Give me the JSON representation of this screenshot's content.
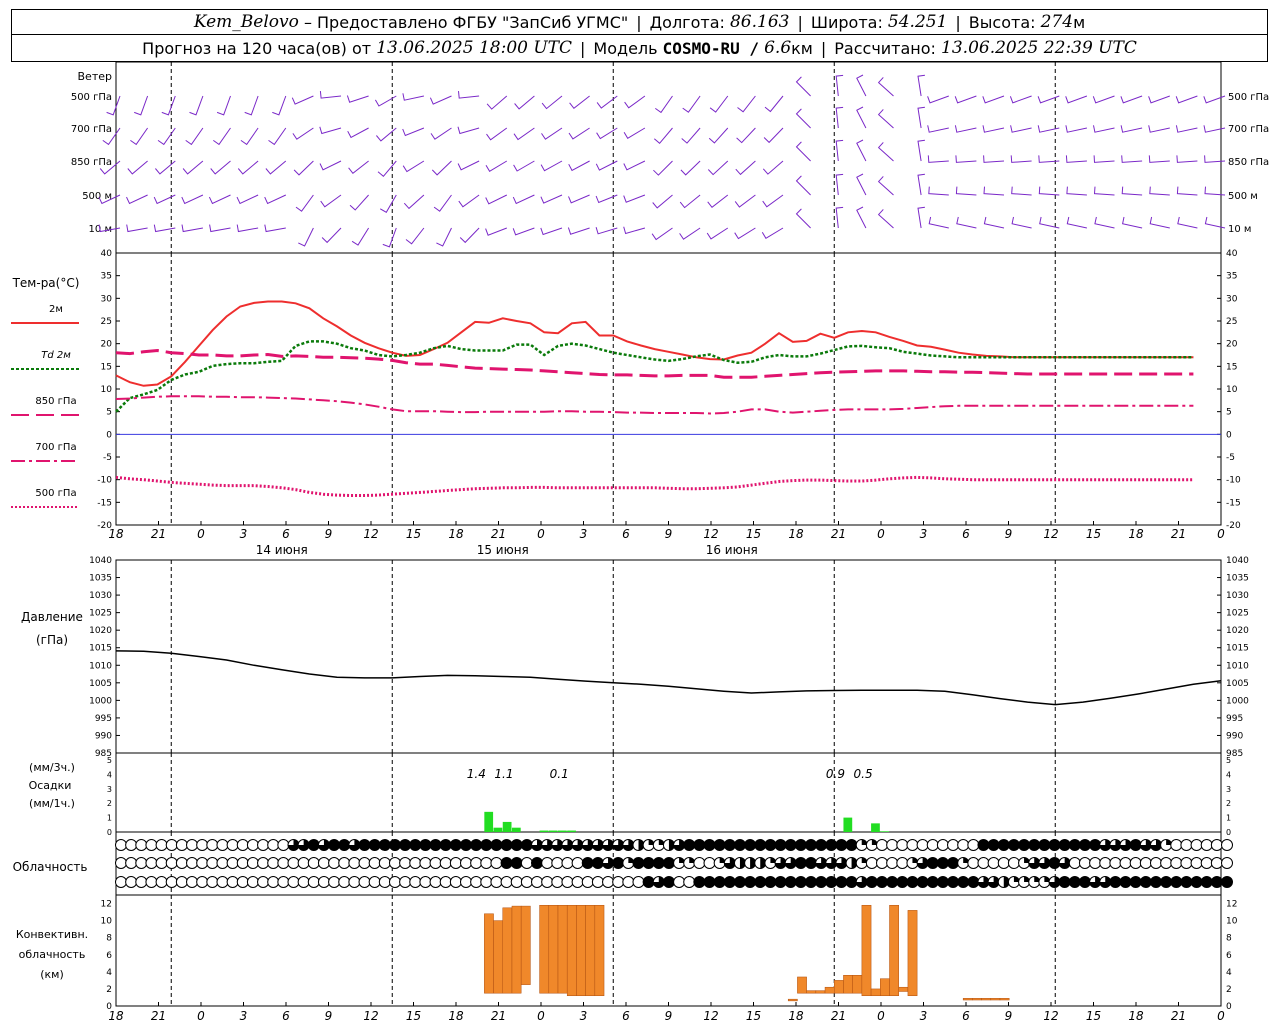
{
  "header": {
    "station": "Kem_Belovo",
    "provider": "– Предоставлено ФГБУ \"ЗапСиб УГМС\"",
    "lon_label": "Долгота:",
    "lon": "86.163",
    "lat_label": "Широта:",
    "lat": "54.251",
    "alt_label": "Высота:",
    "alt": "274",
    "alt_unit": "м",
    "forecast_label": "Прогноз на 120 часа(ов) от",
    "forecast_from": "13.06.2025 18:00 UTC",
    "model_label": "Модель",
    "model": "COSMO-RU /",
    "resolution": "6.6",
    "resolution_unit": "км",
    "computed_label": "Рассчитано:",
    "computed": "13.06.2025 22:39 UTC"
  },
  "colors": {
    "t2m": "#ee2e2e",
    "td2m": "#0a7a0a",
    "t850": "#e0146e",
    "t700": "#e0146e",
    "t500": "#e0146e",
    "wind": "#7a28c8",
    "precip": "#22dd22",
    "convective": "#f0882a",
    "pressure": "#000000"
  },
  "chart_data": [
    {
      "id": "wind",
      "type": "barbs",
      "title": "Ветер",
      "levels": [
        "500 гПа",
        "700 гПа",
        "850 гПа",
        "500  м",
        "10   м"
      ]
    },
    {
      "id": "temperature",
      "type": "line",
      "title": "Тем-ра(°C)",
      "ylim": [
        -20,
        40
      ],
      "yticks": [
        -20,
        -15,
        -10,
        -5,
        0,
        5,
        10,
        15,
        20,
        25,
        30,
        35,
        40
      ],
      "x_hours": [
        0,
        3,
        6,
        9,
        12,
        15,
        18,
        21,
        24,
        27,
        30,
        33,
        36,
        39,
        42,
        45,
        48,
        51,
        54,
        57,
        60,
        63,
        66,
        69,
        72,
        75,
        78,
        81,
        84,
        87,
        90,
        93,
        96,
        99,
        102,
        105,
        108,
        111,
        114,
        117,
        120,
        123,
        126,
        129,
        132,
        135,
        138,
        141,
        144,
        147,
        150,
        153,
        156,
        159,
        162,
        165,
        168,
        171,
        174,
        177,
        180,
        183,
        186,
        189,
        192,
        195,
        198,
        201,
        204,
        207,
        210,
        213,
        216,
        219,
        222,
        225,
        228,
        231,
        234
      ],
      "series": [
        {
          "name": "2м",
          "key": "t2m",
          "values": [
            13.0,
            11.5,
            10.7,
            11.0,
            12.8,
            16.0,
            19.5,
            23.0,
            26.0,
            28.2,
            29.0,
            29.3,
            29.3,
            28.9,
            27.8,
            25.6,
            23.8,
            21.8,
            20.2,
            19.0,
            18.0,
            17.3,
            17.5,
            18.8,
            20.2,
            22.5,
            24.8,
            24.6,
            25.6,
            25.0,
            24.5,
            22.5,
            22.3,
            24.5,
            24.8,
            21.8,
            21.8,
            20.5,
            19.6,
            18.8,
            18.2,
            17.6,
            17.0,
            16.6,
            16.5,
            17.4,
            18.0,
            20.0,
            22.3,
            20.4,
            20.6,
            22.2,
            21.3,
            22.5,
            22.8,
            22.5,
            21.5,
            20.6,
            19.6,
            19.3,
            18.7,
            18.0,
            17.6,
            17.3,
            17.2,
            17.0,
            17.0,
            17.0,
            17.0,
            17.0,
            17.0,
            17.0,
            17.0,
            17.0,
            17.0,
            17.0,
            17.0,
            17.0,
            17.0
          ]
        },
        {
          "name": "Td  2м",
          "key": "td2m",
          "values": [
            5.0,
            8.0,
            8.8,
            9.8,
            12.0,
            13.2,
            13.8,
            15.1,
            15.5,
            15.7,
            15.7,
            16.0,
            16.2,
            19.5,
            20.5,
            20.5,
            20.0,
            19.0,
            18.5,
            17.5,
            17.2,
            17.5,
            18.0,
            19.0,
            19.5,
            18.8,
            18.5,
            18.5,
            18.5,
            19.8,
            19.8,
            17.5,
            19.5,
            20.0,
            19.6,
            18.8,
            18.0,
            17.5,
            17.0,
            16.5,
            16.2,
            16.6,
            17.2,
            17.6,
            16.4,
            15.8,
            16.0,
            17.0,
            17.5,
            17.2,
            17.2,
            17.8,
            18.6,
            19.4,
            19.5,
            19.2,
            19.0,
            18.2,
            17.8,
            17.4,
            17.2,
            17.0,
            17.0,
            17.0,
            17.0,
            17.0,
            17.0,
            17.0,
            17.0,
            17.0,
            17.0,
            17.0,
            17.0,
            17.0,
            17.0,
            17.0,
            17.0,
            17.0,
            17.0
          ]
        },
        {
          "name": "850 гПа",
          "key": "t850",
          "values": [
            18.0,
            17.8,
            18.2,
            18.5,
            18.0,
            17.8,
            17.5,
            17.5,
            17.3,
            17.3,
            17.5,
            17.6,
            17.2,
            17.3,
            17.2,
            17.0,
            17.0,
            16.9,
            16.8,
            16.6,
            16.3,
            15.8,
            15.5,
            15.5,
            15.2,
            14.9,
            14.6,
            14.5,
            14.4,
            14.3,
            14.2,
            14.0,
            13.8,
            13.6,
            13.4,
            13.2,
            13.1,
            13.1,
            13.0,
            12.9,
            12.9,
            13.0,
            13.0,
            13.0,
            12.6,
            12.6,
            12.6,
            12.8,
            13.0,
            13.2,
            13.4,
            13.6,
            13.7,
            13.8,
            13.9,
            14.0,
            14.0,
            14.0,
            13.9,
            13.8,
            13.8,
            13.7,
            13.7,
            13.6,
            13.5,
            13.4,
            13.3,
            13.3,
            13.3,
            13.3,
            13.3,
            13.3,
            13.3,
            13.3,
            13.3,
            13.3,
            13.3,
            13.3,
            13.3
          ]
        },
        {
          "name": "700 гПа",
          "key": "t700",
          "values": [
            7.8,
            7.9,
            8.1,
            8.3,
            8.4,
            8.4,
            8.4,
            8.3,
            8.3,
            8.2,
            8.2,
            8.1,
            8.0,
            7.9,
            7.7,
            7.5,
            7.3,
            7.0,
            6.6,
            6.1,
            5.5,
            5.1,
            5.1,
            5.1,
            5.0,
            4.9,
            4.9,
            5.0,
            5.0,
            5.0,
            5.0,
            5.0,
            5.1,
            5.1,
            5.0,
            5.0,
            4.9,
            4.8,
            4.8,
            4.7,
            4.7,
            4.7,
            4.7,
            4.6,
            4.7,
            5.0,
            5.5,
            5.5,
            5.0,
            4.8,
            5.0,
            5.2,
            5.4,
            5.5,
            5.5,
            5.5,
            5.5,
            5.6,
            5.8,
            6.0,
            6.2,
            6.3,
            6.3,
            6.3,
            6.3,
            6.3,
            6.3,
            6.3,
            6.3,
            6.3,
            6.3,
            6.3,
            6.3,
            6.3,
            6.3,
            6.3,
            6.3,
            6.3,
            6.3
          ]
        },
        {
          "name": "500 гПа",
          "key": "t500",
          "values": [
            -9.5,
            -9.8,
            -10.0,
            -10.3,
            -10.6,
            -10.8,
            -11.0,
            -11.2,
            -11.3,
            -11.3,
            -11.3,
            -11.5,
            -11.8,
            -12.2,
            -12.8,
            -13.2,
            -13.4,
            -13.5,
            -13.5,
            -13.4,
            -13.2,
            -13.0,
            -12.8,
            -12.6,
            -12.4,
            -12.2,
            -12.0,
            -11.9,
            -11.8,
            -11.8,
            -11.7,
            -11.7,
            -11.8,
            -11.8,
            -11.8,
            -11.8,
            -11.8,
            -11.8,
            -11.8,
            -11.8,
            -11.9,
            -12.0,
            -12.0,
            -11.9,
            -11.8,
            -11.6,
            -11.2,
            -10.8,
            -10.4,
            -10.2,
            -10.1,
            -10.1,
            -10.2,
            -10.3,
            -10.3,
            -10.1,
            -9.8,
            -9.6,
            -9.5,
            -9.6,
            -9.8,
            -9.9,
            -10.0,
            -10.0,
            -10.0,
            -10.0,
            -10.0,
            -10.0,
            -10.0,
            -10.0,
            -10.0,
            -10.0,
            -10.0,
            -10.0,
            -10.0,
            -10.0,
            -10.0,
            -10.0,
            -10.0
          ]
        }
      ]
    },
    {
      "id": "pressure",
      "type": "line",
      "title": "Давление",
      "unit": "(гПа)",
      "ylim": [
        985,
        1040
      ],
      "yticks": [
        985,
        990,
        995,
        1000,
        1005,
        1010,
        1015,
        1020,
        1025,
        1030,
        1035,
        1040
      ],
      "x_hours": [
        0,
        3,
        6,
        9,
        12,
        15,
        18,
        21,
        24,
        27,
        30,
        33,
        36,
        39,
        42,
        45,
        48,
        51,
        54,
        57,
        60,
        63,
        66,
        69,
        72,
        75,
        78,
        81,
        84,
        87,
        90,
        93,
        96,
        99,
        102,
        105,
        108,
        111,
        114,
        117,
        120
      ],
      "values": [
        1014.1,
        1014.0,
        1013.4,
        1012.5,
        1011.5,
        1010.0,
        1008.7,
        1007.5,
        1006.6,
        1006.4,
        1006.4,
        1006.8,
        1007.1,
        1007.0,
        1006.8,
        1006.6,
        1006.0,
        1005.5,
        1005.0,
        1004.6,
        1004.0,
        1003.3,
        1002.6,
        1002.1,
        1002.4,
        1002.7,
        1002.8,
        1002.9,
        1002.9,
        1002.9,
        1002.6,
        1001.6,
        1000.5,
        999.5,
        998.8,
        999.5,
        1000.6,
        1001.8,
        1003.2,
        1004.6,
        1005.6
      ]
    },
    {
      "id": "precip",
      "type": "bar",
      "title": "Осадки",
      "units": [
        "(мм/3ч.)",
        "(мм/1ч.)"
      ],
      "ylim": [
        0,
        5
      ],
      "yticks": [
        0,
        1,
        2,
        3,
        4,
        5
      ],
      "labels": [
        {
          "hour": 40,
          "text": "1.4"
        },
        {
          "hour": 43,
          "text": "1.1"
        },
        {
          "hour": 49,
          "text": "0.1"
        },
        {
          "hour": 79,
          "text": "0.9"
        },
        {
          "hour": 82,
          "text": "0.5"
        }
      ],
      "bars": [
        {
          "hour": 40,
          "value": 1.4
        },
        {
          "hour": 41,
          "value": 0.3
        },
        {
          "hour": 42,
          "value": 0.7
        },
        {
          "hour": 43,
          "value": 0.3
        },
        {
          "hour": 46,
          "value": 0.1
        },
        {
          "hour": 47,
          "value": 0.1
        },
        {
          "hour": 48,
          "value": 0.1
        },
        {
          "hour": 49,
          "value": 0.1
        },
        {
          "hour": 79,
          "value": 1.0
        },
        {
          "hour": 82,
          "value": 0.6
        },
        {
          "hour": 83,
          "value": 0.05
        }
      ]
    },
    {
      "id": "cloudiness",
      "type": "table",
      "title": "Облачность",
      "rows": [
        "00000000000000000334344344444444444444444333333333321123444444444444444441100000000004444444444443334331000000",
        "00000000000000000000000000000000000000440400004434144441100132221334433321000013444100000133430000000000000000",
        "00000000000000000000000000000000000000000000000000004340044444444444444443444444444443321111344433444444444444"
      ]
    },
    {
      "id": "convective",
      "type": "bar",
      "title": "Конвективн.",
      "title2": "облачность",
      "unit": "(км)",
      "ylim": [
        0,
        13
      ],
      "yticks": [
        0,
        2,
        4,
        6,
        8,
        10,
        12
      ],
      "bars": [
        [
          40,
          1.5,
          10.8
        ],
        [
          41,
          1.5,
          10.0
        ],
        [
          42,
          1.5,
          11.5
        ],
        [
          43,
          1.5,
          11.7
        ],
        [
          44,
          2.5,
          11.7
        ],
        [
          46,
          1.5,
          11.8
        ],
        [
          47,
          1.5,
          11.8
        ],
        [
          48,
          1.5,
          11.8
        ],
        [
          49,
          1.2,
          11.8
        ],
        [
          50,
          1.2,
          11.8
        ],
        [
          51,
          1.2,
          11.8
        ],
        [
          52,
          1.2,
          11.8
        ],
        [
          73,
          0.6,
          0.8
        ],
        [
          74,
          1.5,
          3.4
        ],
        [
          75,
          1.5,
          1.8
        ],
        [
          76,
          1.5,
          1.8
        ],
        [
          77,
          1.5,
          2.2
        ],
        [
          78,
          1.5,
          3.0
        ],
        [
          79,
          1.5,
          3.6
        ],
        [
          80,
          1.5,
          3.6
        ],
        [
          81,
          1.2,
          11.8
        ],
        [
          82,
          1.2,
          2.0
        ],
        [
          83,
          1.2,
          3.2
        ],
        [
          84,
          1.2,
          11.8
        ],
        [
          85,
          1.7,
          2.2
        ],
        [
          86,
          1.2,
          11.2
        ],
        [
          92,
          0.7,
          0.9
        ],
        [
          93,
          0.7,
          0.9
        ],
        [
          94,
          0.7,
          0.9
        ],
        [
          95,
          0.7,
          0.9
        ],
        [
          96,
          0.7,
          0.9
        ]
      ]
    },
    {
      "id": "axis",
      "type": "axis",
      "tick_labels": [
        "18",
        "21",
        "0",
        "3",
        "6",
        "9",
        "12",
        "15",
        "18",
        "21",
        "0",
        "3",
        "6",
        "9",
        "12",
        "15",
        "18",
        "21",
        "0",
        "3",
        "6",
        "9",
        "12",
        "15",
        "18",
        "21",
        "0"
      ],
      "day_labels": [
        "14 июня",
        "15 июня",
        "16 июня"
      ]
    }
  ]
}
